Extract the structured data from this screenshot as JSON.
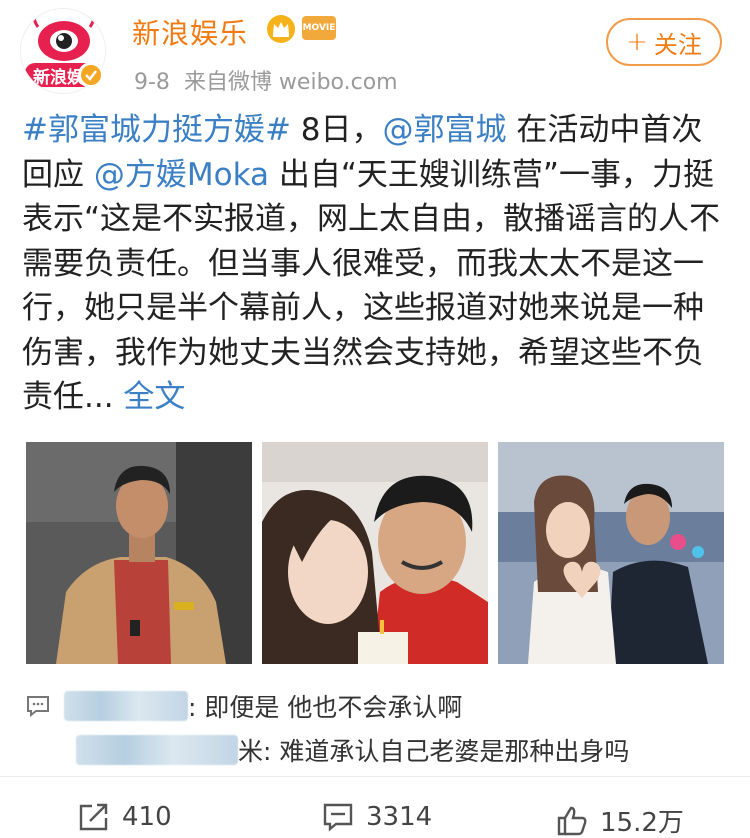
{
  "header": {
    "username": "新浪娱乐",
    "avatar_text": "新浪娱",
    "movie_badge": "MOVIE",
    "date": "9-8",
    "source": "来自微博 weibo.com",
    "follow_label": "关注",
    "follow_plus": "+"
  },
  "post": {
    "tag": "#郭富城力挺方媛#",
    "text1": " 8日，",
    "mention1": "@郭富城",
    "text2": " 在活动中首次回应 ",
    "mention2": "@方媛Moka",
    "text3": " 出自“天王嫂训练营”一事，力挺表示“这是不实报道，网上太自由，散播谣言的人不需要负责任。但当事人很难受，而我太太不是这一行，她只是半个幕前人，这些报道对她来说是一种伤害，我作为她丈夫当然会支持她，希望这些不负责任...",
    "full_text_label": " 全文"
  },
  "comments": [
    {
      "text": ": 即便是 他也不会承认啊"
    },
    {
      "text": "米: 难道承认自己老婆是那种出身吗"
    }
  ],
  "actions": {
    "repost_count": "410",
    "comment_count": "3314",
    "like_count": "15.2万"
  },
  "colors": {
    "brand_orange": "#f27b11",
    "link_blue": "#3b7fc4"
  }
}
